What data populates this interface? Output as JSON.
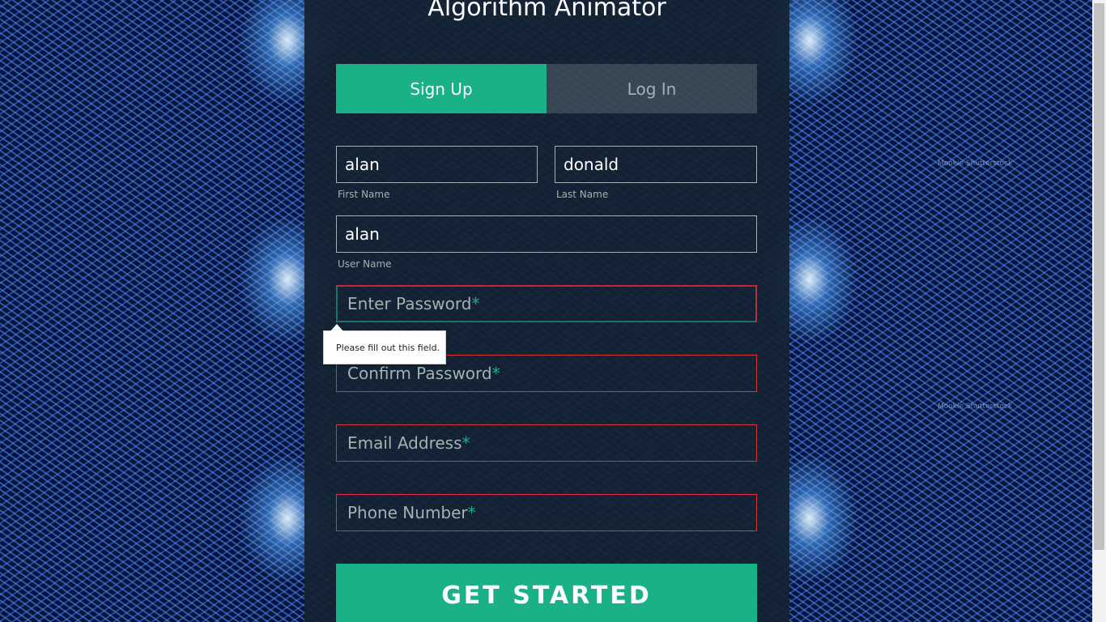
{
  "app_title": "Algorithm Animator",
  "tabs": {
    "signup": "Sign Up",
    "login": "Log In",
    "active": "signup"
  },
  "form": {
    "first_name": {
      "value": "alan",
      "label": "First Name"
    },
    "last_name": {
      "value": "donald",
      "label": "Last Name"
    },
    "user_name": {
      "value": "alan",
      "label": "User Name"
    },
    "password": {
      "placeholder": "Enter Password",
      "required_mark": "*"
    },
    "confirm_password": {
      "placeholder": "Confirm Password",
      "required_mark": "*"
    },
    "email": {
      "placeholder": "Email Address",
      "required_mark": "*"
    },
    "phone": {
      "placeholder": "Phone Number",
      "required_mark": "*"
    }
  },
  "validation_tooltip": "Please fill out this field.",
  "submit_label": "GET STARTED",
  "watermarks": [
    "Mookie Shutterstock",
    "Mookie Shutterstock"
  ],
  "colors": {
    "accent": "#1ab188",
    "error": "#e0303a",
    "muted": "#a0b3b0",
    "panel": "#142232"
  }
}
